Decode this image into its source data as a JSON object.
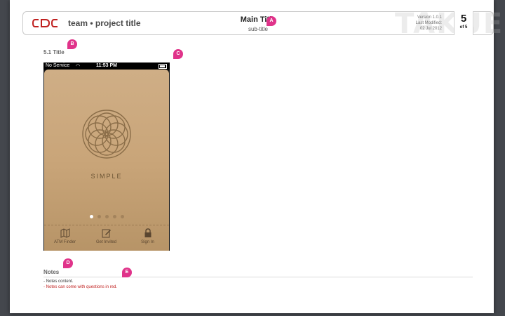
{
  "header": {
    "logo_text": "CDC",
    "team_title": "team • project title",
    "main_title": "Main Title",
    "sub_title": "sub-title",
    "watermark": "TAKUE",
    "version": "Version 1.0.1",
    "last_modified_label": "Last Modified:",
    "last_modified_date": "02 Jul 2012",
    "page_number": "5",
    "page_of": "of 5"
  },
  "annotations": {
    "a": "A",
    "b": "B",
    "c": "C",
    "d": "D",
    "e": "E"
  },
  "section": {
    "title": "5.1 Title"
  },
  "phone": {
    "carrier": "No Service",
    "time": "11:53 PM",
    "brand": "SIMPLE",
    "page_dots": 5,
    "active_dot": 1,
    "tabs": [
      {
        "label": "ATM Finder",
        "icon": "map-icon"
      },
      {
        "label": "Get Invited",
        "icon": "edit-icon"
      },
      {
        "label": "Sign In",
        "icon": "lock-icon"
      }
    ]
  },
  "notes": {
    "title": "Notes",
    "lines": [
      {
        "text": "- Notes content.",
        "color": "#333333"
      },
      {
        "text": "- Notes can come with questions in red.",
        "color": "#c0201f"
      }
    ]
  },
  "colors": {
    "badge": "#e0338a",
    "logo": "#c0201f",
    "screen": "#cfae86"
  }
}
